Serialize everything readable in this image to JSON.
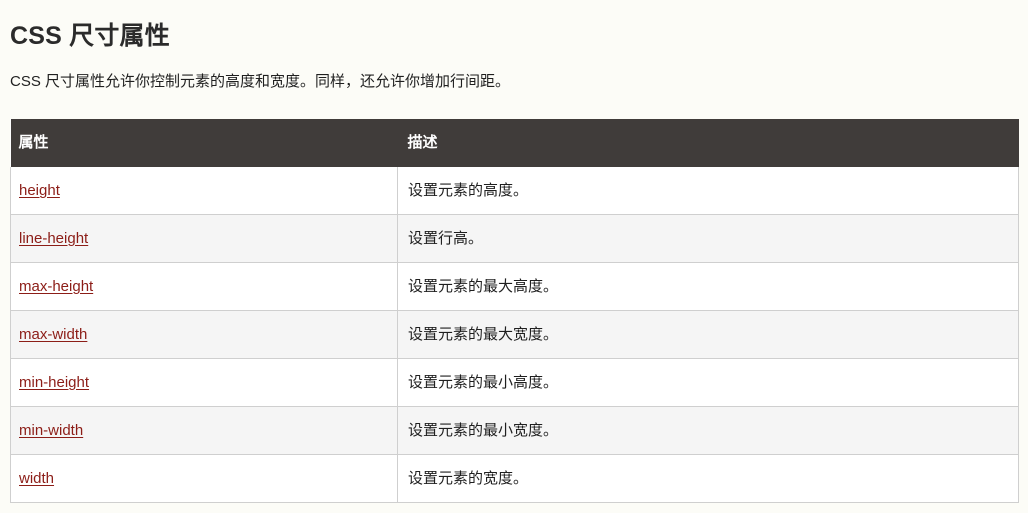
{
  "page": {
    "title": "CSS 尺寸属性",
    "intro": "CSS 尺寸属性允许你控制元素的高度和宽度。同样，还允许你增加行间距。",
    "background_color": "#fcfcf7"
  },
  "table": {
    "header_bg": "#403c3a",
    "header_text_color": "#ffffff",
    "stripe_color": "#f5f5f5",
    "border_color": "#cfcfcf",
    "link_color": "#8c1d17",
    "columns": [
      {
        "label": "属性"
      },
      {
        "label": "描述"
      }
    ],
    "rows": [
      {
        "property": "height",
        "description": "设置元素的高度。"
      },
      {
        "property": "line-height",
        "description": "设置行高。"
      },
      {
        "property": "max-height",
        "description": "设置元素的最大高度。"
      },
      {
        "property": "max-width",
        "description": "设置元素的最大宽度。"
      },
      {
        "property": "min-height",
        "description": "设置元素的最小高度。"
      },
      {
        "property": "min-width",
        "description": "设置元素的最小宽度。"
      },
      {
        "property": "width",
        "description": "设置元素的宽度。"
      }
    ]
  }
}
